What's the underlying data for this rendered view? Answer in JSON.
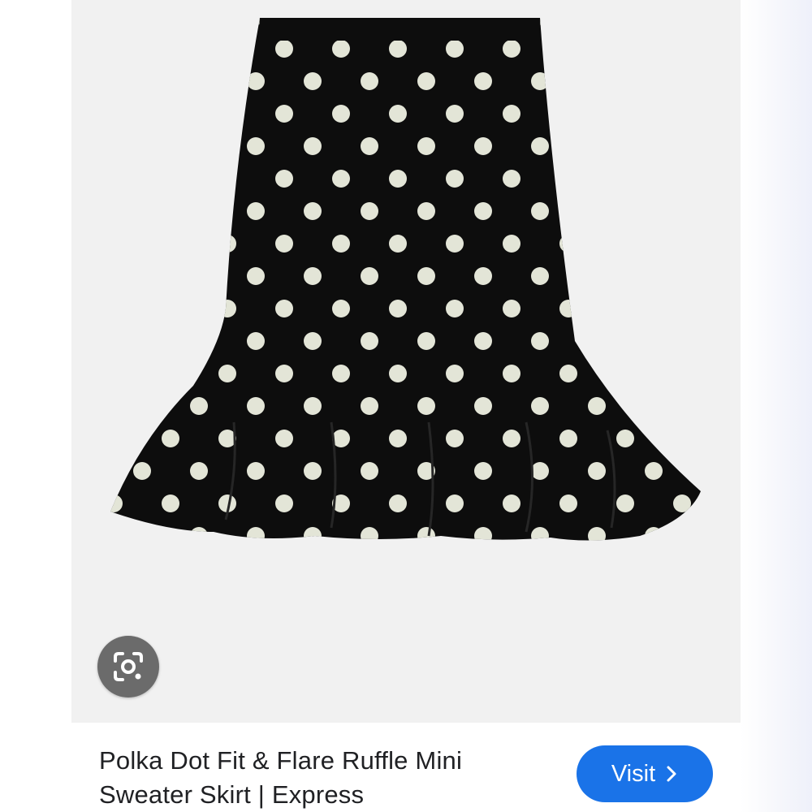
{
  "product": {
    "title_line1": "Polka Dot Fit & Flare Ruffle Mini",
    "title_line2": "Sweater Skirt | Express"
  },
  "actions": {
    "visit_label": "Visit",
    "visit_icon": "chevron-right-icon",
    "lens_icon": "google-lens-icon"
  },
  "colors": {
    "panel_bg": "#f1f1f1",
    "skirt": "#0d0d0d",
    "dots": "#e3e5d7",
    "visit_button": "#1a73e8",
    "lens_button": "#6b6b6b"
  }
}
